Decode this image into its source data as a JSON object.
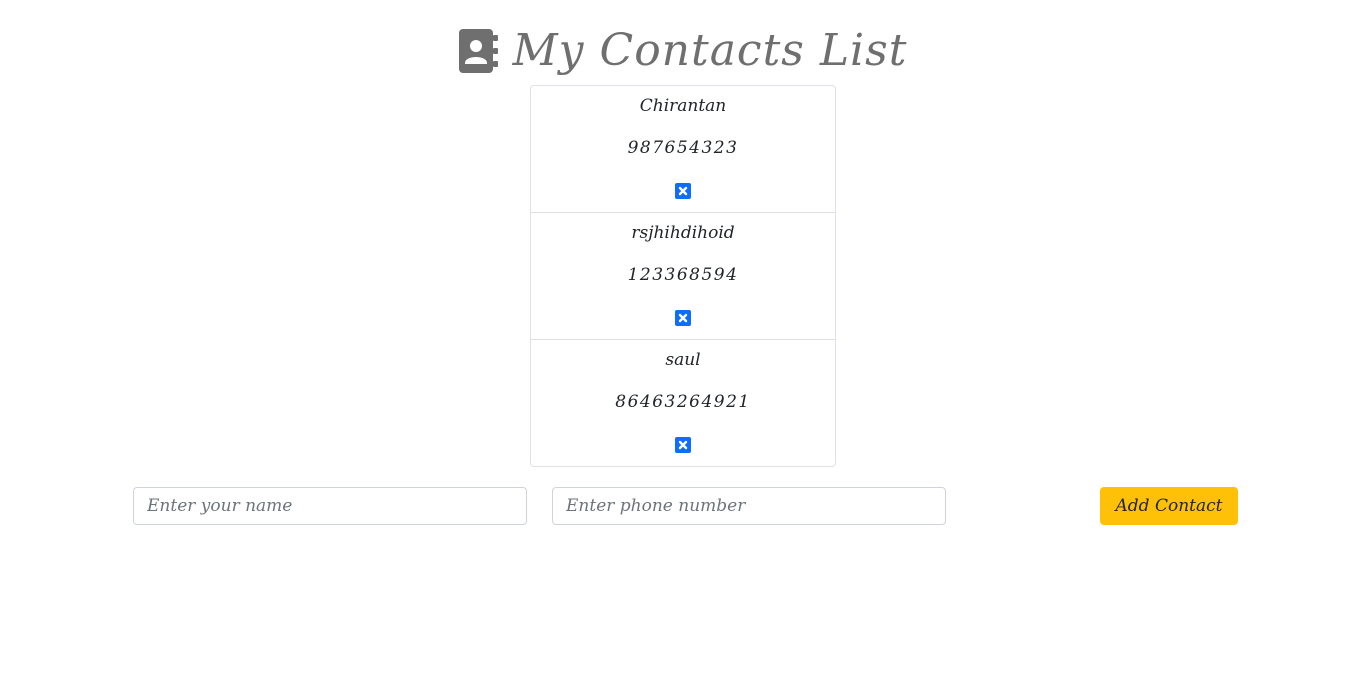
{
  "header": {
    "title": "My Contacts List",
    "icon": "address-book-icon",
    "icon_color": "#6f6f6f"
  },
  "contacts": [
    {
      "name": "Chirantan",
      "phone": "987654323",
      "delete_icon": "close-square-icon"
    },
    {
      "name": "rsjhihdihoid",
      "phone": "123368594",
      "delete_icon": "close-square-icon"
    },
    {
      "name": "saul",
      "phone": "86463264921",
      "delete_icon": "close-square-icon"
    }
  ],
  "form": {
    "name_value": "",
    "name_placeholder": "Enter your name",
    "phone_value": "",
    "phone_placeholder": "Enter phone number",
    "add_label": "Add Contact"
  },
  "colors": {
    "accent_blue": "#0d6efd",
    "button_yellow": "#ffc107",
    "border": "#dee2e6"
  }
}
